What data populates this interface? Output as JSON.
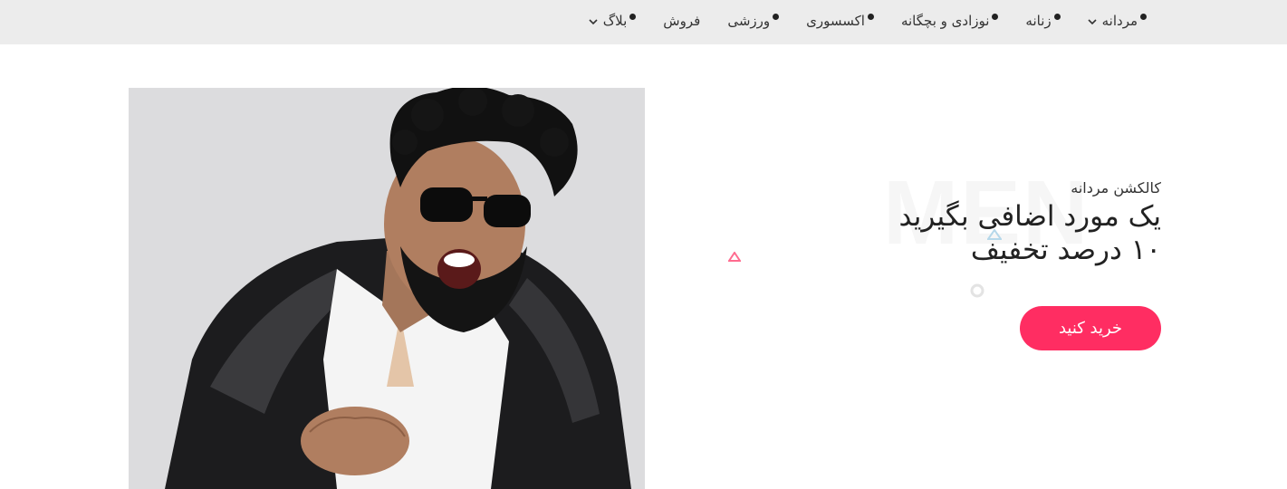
{
  "nav": {
    "items": [
      {
        "label": "مردانه",
        "has_dropdown": true
      },
      {
        "label": "زنانه",
        "has_dropdown": false
      },
      {
        "label": "نوزادی و بچگانه",
        "has_dropdown": false
      },
      {
        "label": "اکسسوری",
        "has_dropdown": false
      },
      {
        "label": "ورزشی",
        "has_dropdown": false
      },
      {
        "label": "فروش",
        "has_dropdown": false
      },
      {
        "label": "بلاگ",
        "has_dropdown": true
      }
    ]
  },
  "hero": {
    "background_word": "MEN",
    "subtitle": "کالکشن مردانه",
    "title_line1": "یک مورد اضافی بگیرید",
    "title_line2": "۱۰ درصد تخفیف",
    "button_label": "خرید کنید",
    "accent_color": "#ff2d62"
  }
}
